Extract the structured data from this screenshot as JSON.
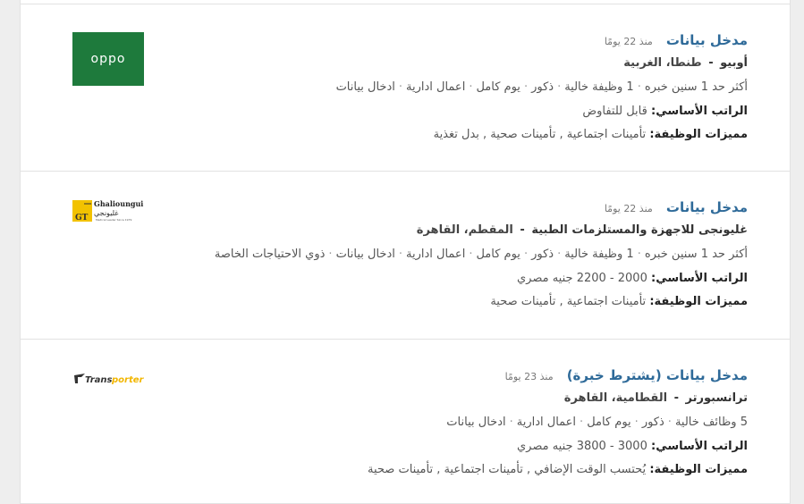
{
  "jobs": [
    {
      "title": "مدخل بيانات",
      "posted": "منذ 22 يومًا",
      "company": "أوبيو",
      "location": "طنطا، الغربية",
      "requirements": [
        "أكثر حد 1 سنين خبره",
        "1 وظيفة خالية",
        "ذكور",
        "يوم كامل",
        "اعمال ادارية",
        "ادخال بيانات"
      ],
      "salary_label": "الراتب الأساسي:",
      "salary": "قابل للتفاوض",
      "benefits_label": "مميزات الوظيفة:",
      "benefits": "تأمينات اجتماعية , تأمينات صحية , بدل تغذية",
      "logo_text": "oppo",
      "logo_color": "#1e7a3c"
    },
    {
      "title": "مدخل بيانات",
      "posted": "منذ 22 يومًا",
      "company": "غليونجى للاجهزة والمستلزمات الطبية",
      "location": "المقطم، القاهرة",
      "requirements": [
        "أكثر حد 1 سنين خبره",
        "1 وظيفة خالية",
        "ذكور",
        "يوم كامل",
        "اعمال ادارية",
        "ادخال بيانات",
        "ذوي الاحتياجات الخاصة"
      ],
      "salary_label": "الراتب الأساسي:",
      "salary": "2000 - 2200 جنيه مصري",
      "benefits_label": "مميزات الوظيفة:",
      "benefits": "تأمينات اجتماعية , تأمينات صحية",
      "logo_text": "Ghalioungui",
      "logo_text_ar": "غليونجي",
      "logo_initials": "GT",
      "logo_tagline": "Medical Leader Since 1979",
      "logo_color": "#f2c200"
    },
    {
      "title": "مدخل بيانات (يشترط خبرة)",
      "posted": "منذ 23 يومًا",
      "company": "ترانسبورتر",
      "location": "القطامية، القاهرة",
      "requirements": [
        "5 وظائف خالية",
        "ذكور",
        "يوم كامل",
        "اعمال ادارية",
        "ادخال بيانات"
      ],
      "salary_label": "الراتب الأساسي:",
      "salary": "3000 - 3800 جنيه مصري",
      "benefits_label": "مميزات الوظيفة:",
      "benefits": "يُحتسب الوقت الإضافي , تأمينات اجتماعية , تأمينات صحية",
      "logo_text_a": "Trans",
      "logo_text_b": "porter",
      "logo_color": "#f2b600"
    }
  ]
}
